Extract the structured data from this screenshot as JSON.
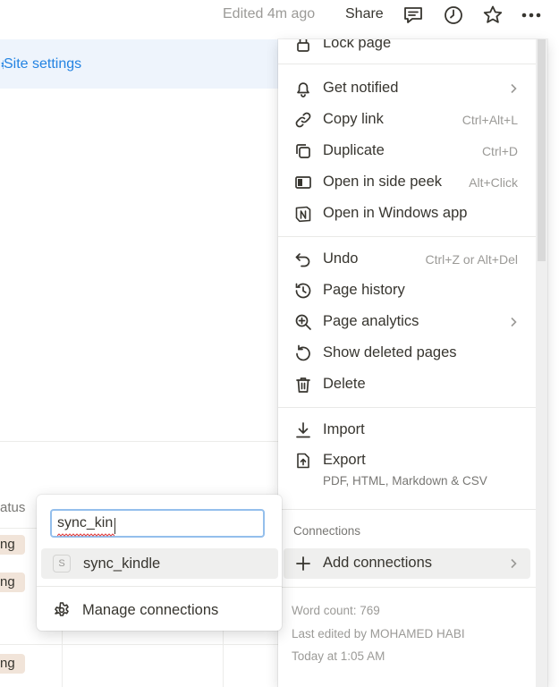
{
  "topbar": {
    "edited": "Edited 4m ago",
    "share": "Share",
    "icons": [
      "comment-icon",
      "clock-icon",
      "star-icon",
      "more-icon"
    ]
  },
  "page": {
    "site_settings": "Site settings",
    "status_fragment": "atus",
    "tag_fragment": "ng"
  },
  "menu": {
    "lock_page": "Lock page",
    "items_a": [
      {
        "label": "Get notified",
        "shortcut": "",
        "icon": "bell-icon",
        "chevron": true
      },
      {
        "label": "Copy link",
        "shortcut": "Ctrl+Alt+L",
        "icon": "link-icon",
        "chevron": false
      },
      {
        "label": "Duplicate",
        "shortcut": "Ctrl+D",
        "icon": "duplicate-icon",
        "chevron": false
      },
      {
        "label": "Open in side peek",
        "shortcut": "Alt+Click",
        "icon": "side-peek-icon",
        "chevron": false
      },
      {
        "label": "Open in Windows app",
        "shortcut": "",
        "icon": "notion-app-icon",
        "chevron": false
      }
    ],
    "items_b": [
      {
        "label": "Undo",
        "shortcut": "Ctrl+Z or Alt+Del",
        "icon": "undo-icon",
        "chevron": false
      },
      {
        "label": "Page history",
        "shortcut": "",
        "icon": "history-icon",
        "chevron": false
      },
      {
        "label": "Page analytics",
        "shortcut": "",
        "icon": "analytics-icon",
        "chevron": true
      },
      {
        "label": "Show deleted pages",
        "shortcut": "",
        "icon": "restore-icon",
        "chevron": false
      },
      {
        "label": "Delete",
        "shortcut": "",
        "icon": "trash-icon",
        "chevron": false
      }
    ],
    "import": "Import",
    "export": "Export",
    "export_formats": "PDF, HTML, Markdown & CSV",
    "connections_label": "Connections",
    "add_connections": "Add connections",
    "word_count": "Word count: 769",
    "last_edited_by": "Last edited by MOHAMED HABI",
    "last_edited_at": "Today at 1:05 AM"
  },
  "popup": {
    "search_value": "sync_kin",
    "result_badge": "S",
    "result_label": "sync_kindle",
    "manage": "Manage connections"
  }
}
